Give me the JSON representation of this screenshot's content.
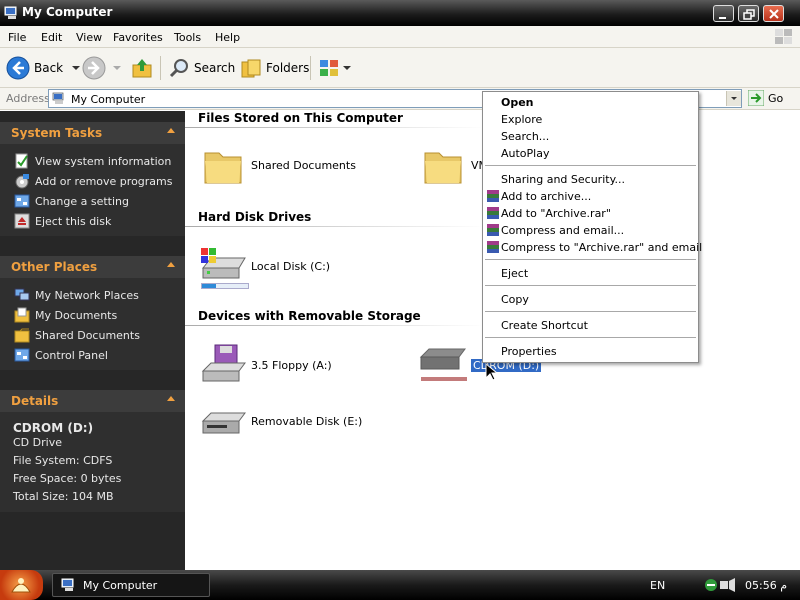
{
  "window": {
    "title": "My Computer"
  },
  "menubar": {
    "items": [
      "File",
      "Edit",
      "View",
      "Favorites",
      "Tools",
      "Help"
    ]
  },
  "toolbar": {
    "back": "Back",
    "search": "Search",
    "folders": "Folders"
  },
  "address": {
    "label": "Address",
    "value": "My Computer",
    "go": "Go"
  },
  "sidebar": {
    "system_tasks": {
      "title": "System Tasks",
      "items": [
        "View system information",
        "Add or remove programs",
        "Change a setting",
        "Eject this disk"
      ]
    },
    "other_places": {
      "title": "Other Places",
      "items": [
        "My Network Places",
        "My Documents",
        "Shared Documents",
        "Control Panel"
      ]
    },
    "details": {
      "title": "Details",
      "name": "CDROM (D:)",
      "type": "CD Drive",
      "file_system": "File System: CDFS",
      "free_space": "Free Space: 0 bytes",
      "total_size": "Total Size: 104 MB"
    }
  },
  "content": {
    "files_stored": {
      "header": "Files Stored on This Computer",
      "items": [
        "Shared Documents",
        "VM"
      ]
    },
    "hard_disks": {
      "header": "Hard Disk Drives",
      "items": [
        "Local Disk (C:)"
      ],
      "usage_fraction": 0.3
    },
    "removable": {
      "header": "Devices with Removable Storage",
      "items": [
        "3.5 Floppy (A:)",
        "CDROM (D:)",
        "Removable Disk (E:)"
      ]
    }
  },
  "context_menu": {
    "items": [
      "Open",
      "Explore",
      "Search...",
      "AutoPlay",
      "Sharing and Security...",
      "Add to archive...",
      "Add to \"Archive.rar\"",
      "Compress and email...",
      "Compress to \"Archive.rar\" and email",
      "Eject",
      "Copy",
      "Create Shortcut",
      "Properties"
    ]
  },
  "taskbar": {
    "window_button": "My Computer",
    "language": "EN",
    "clock": "05:56 م"
  },
  "colors": {
    "accent": "#f0a040",
    "selection": "#316ac5"
  }
}
